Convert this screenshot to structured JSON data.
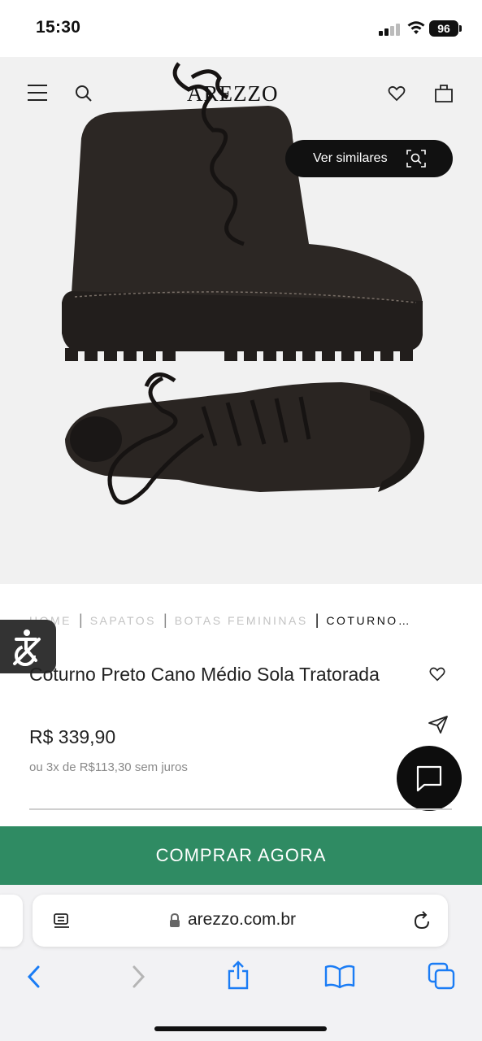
{
  "status_bar": {
    "time": "15:30",
    "battery": "96"
  },
  "header": {
    "brand": "AREZZO"
  },
  "similar_button": {
    "label": "Ver similares"
  },
  "breadcrumb": [
    "HOME",
    "SAPATOS",
    "BOTAS FEMININAS",
    "COTURNO…"
  ],
  "product": {
    "title": "Coturno Preto Cano Médio Sola Tratorada",
    "price": "R$ 339,90",
    "installments": "ou 3x de R$113,30 sem juros"
  },
  "buy_button": {
    "label": "COMPRAR AGORA"
  },
  "browser": {
    "url": "arezzo.com.br"
  },
  "colors": {
    "buy": "#2f8b63",
    "dark": "#111111",
    "hero_bg": "#f1f1f1",
    "link_blue": "#1a7cf5"
  },
  "icons": [
    "menu-icon",
    "search-icon",
    "heart-icon",
    "bag-icon",
    "scan-search-icon",
    "accessibility-icon",
    "share-icon",
    "chat-icon",
    "reader-icon",
    "lock-icon",
    "reload-icon",
    "back-icon",
    "forward-icon",
    "share-sheet-icon",
    "bookmarks-icon",
    "tabs-icon"
  ]
}
